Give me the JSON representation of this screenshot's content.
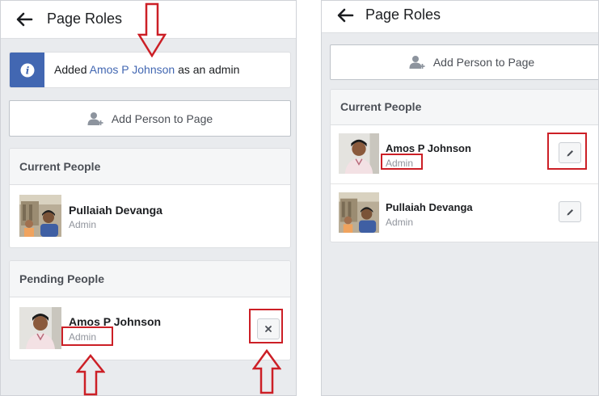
{
  "left": {
    "title": "Page Roles",
    "notice": {
      "prefix": "Added",
      "name": "Amos P Johnson",
      "suffix": "as an admin"
    },
    "add_button": "Add Person to Page",
    "current": {
      "heading": "Current People",
      "people": [
        {
          "name": "Pullaiah Devanga",
          "role": "Admin"
        }
      ]
    },
    "pending": {
      "heading": "Pending People",
      "people": [
        {
          "name": "Amos P Johnson",
          "role": "Admin"
        }
      ]
    }
  },
  "right": {
    "title": "Page Roles",
    "add_button": "Add Person to Page",
    "current": {
      "heading": "Current People",
      "people": [
        {
          "name": "Amos P Johnson",
          "role": "Admin"
        },
        {
          "name": "Pullaiah Devanga",
          "role": "Admin"
        }
      ]
    }
  },
  "colors": {
    "accent": "#4267b2",
    "annotation": "#cc1f26",
    "background": "#e9ebee"
  }
}
